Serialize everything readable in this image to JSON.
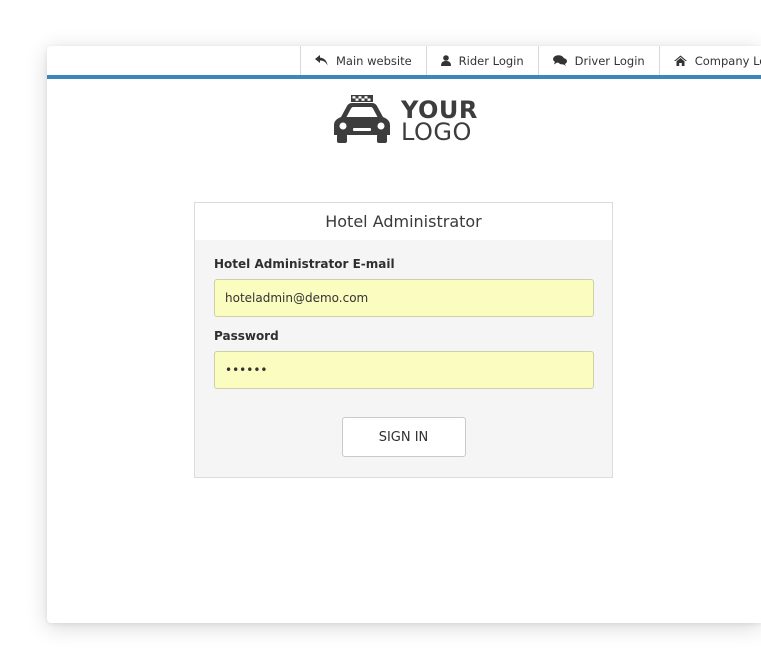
{
  "nav": {
    "items": [
      {
        "label": "Main website",
        "icon": "reply-icon"
      },
      {
        "label": "Rider Login",
        "icon": "user-icon"
      },
      {
        "label": "Driver Login",
        "icon": "comments-icon"
      },
      {
        "label": "Company Login",
        "icon": "home-icon"
      }
    ]
  },
  "logo": {
    "line1": "YOUR",
    "line2": "LOGO",
    "icon": "taxi-car-icon"
  },
  "form": {
    "title": "Hotel Administrator",
    "email_label": "Hotel Administrator E-mail",
    "email_value": "hoteladmin@demo.com",
    "password_label": "Password",
    "password_value": "••••••",
    "submit_label": "SIGN IN"
  },
  "colors": {
    "accent": "#3a87b9",
    "input_fill": "#fafcc0",
    "panel_bg": "#f5f5f5"
  }
}
